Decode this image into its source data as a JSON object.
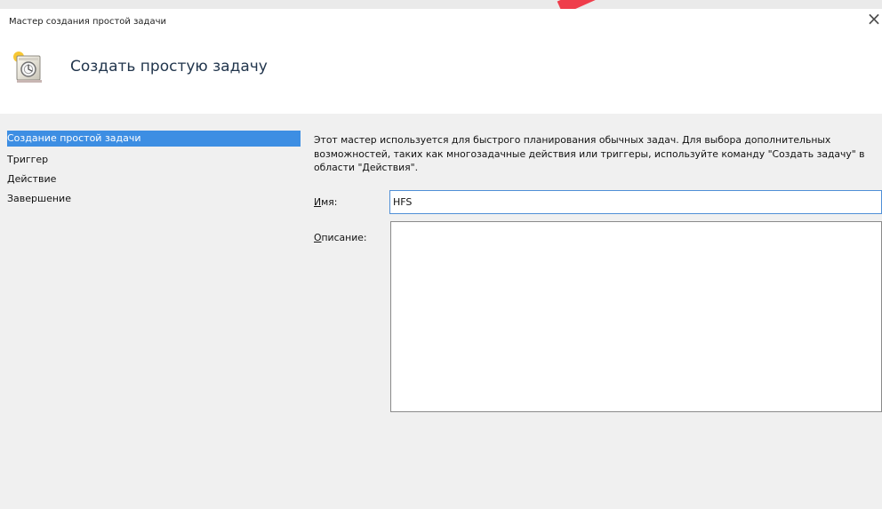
{
  "window": {
    "title": "Мастер создания простой задачи",
    "close_symbol": "×"
  },
  "header": {
    "icon": "task-scheduler-icon",
    "heading": "Создать простую задачу"
  },
  "nav": {
    "items": [
      {
        "label": "Создание простой задачи",
        "selected": true
      },
      {
        "label": "Триггер",
        "selected": false
      },
      {
        "label": "Действие",
        "selected": false
      },
      {
        "label": "Завершение",
        "selected": false
      }
    ]
  },
  "content": {
    "intro": "Этот мастер используется для быстрого планирования обычных задач. Для выбора дополнительных возможностей, таких как многозадачные действия или триггеры, используйте команду \"Создать задачу\" в области \"Действия\".",
    "name_label": {
      "access_key": "И",
      "rest": "мя:"
    },
    "name_value": "HFS",
    "description_label": {
      "access_key": "О",
      "rest": "писание:"
    },
    "description_value": ""
  },
  "colors": {
    "selected_nav_background": "#3d8ee3",
    "selected_nav_text": "#ffffff",
    "focused_input_border": "#4f8fd7",
    "window_background": "#f0f0f0",
    "header_background": "#ffffff"
  }
}
